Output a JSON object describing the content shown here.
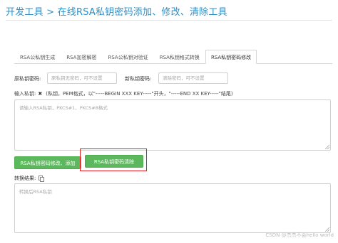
{
  "title": "开发工具 > 在线RSA私钥密码添加、修改、清除工具",
  "tabs": [
    {
      "label": "RSA公私钥生成"
    },
    {
      "label": "RSA加密解密"
    },
    {
      "label": "RSA公私钥对验证"
    },
    {
      "label": "RSA私钥格式转换"
    },
    {
      "label": "RSA私钥密码修改"
    }
  ],
  "active_tab": 4,
  "form": {
    "old_password_label": "原私钥密码:",
    "old_password_placeholder": "原私钥无密码，可不设置",
    "new_password_label": "新私钥密码:",
    "new_password_placeholder": "清除密码，可不设置",
    "input_label": "输入私钥:",
    "clear_icon": "✖",
    "input_hint": "(私钥，PEM格式，以\"-----BEGIN XXX KEY-----\"开头，\"-----END XX KEY-----\"结尾)",
    "input_placeholder": "请输入RSA私钥，PKCS#1、PKCS#8格式",
    "modify_button": "RSA私钥密码修改、添加",
    "clear_button": "RSA私钥密码清除",
    "result_label": "转换结果:",
    "result_placeholder": "转换后RSA私钥"
  },
  "watermark": "CSDN @杰杰不会hello world",
  "colors": {
    "title": "#2c8fc7",
    "button": "#5cb85c",
    "highlight": "#e02020"
  }
}
